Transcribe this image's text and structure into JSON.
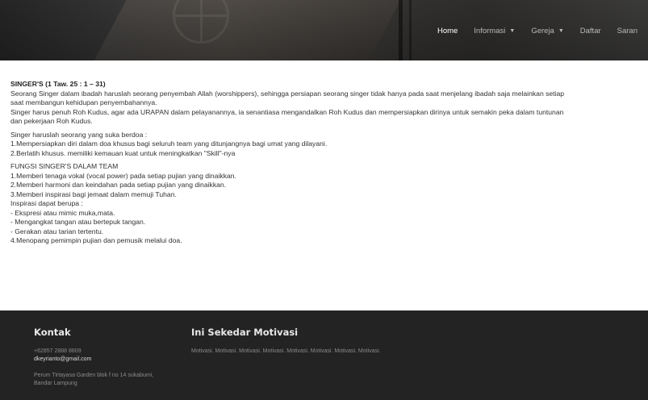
{
  "nav": {
    "items": [
      {
        "label": "Home",
        "active": true,
        "dropdown": false
      },
      {
        "label": "Informasi",
        "active": false,
        "dropdown": true
      },
      {
        "label": "Gereja",
        "active": false,
        "dropdown": true
      },
      {
        "label": "Daftar",
        "active": false,
        "dropdown": false
      },
      {
        "label": "Saran",
        "active": false,
        "dropdown": false
      }
    ],
    "caret_icon": "caret-down-icon"
  },
  "content": {
    "title": "SINGER'S (1 Taw. 25 : 1 – 31)",
    "intro": [
      "Seorang Singer dalam ibadah haruslah seorang penyembah Allah (worshippers), sehingga persiapan seorang singer tidak hanya pada saat menjelang ibadah saja melainkan setiap",
      "saat membangun kehidupan penyembahannya.",
      "Singer harus penuh Roh Kudus, agar ada URAPAN dalam pelayanannya, ia senantiasa mengandalkan Roh Kudus dan mempersiapkan dirinya untuk semakin peka dalam tuntunan",
      "dan pekerjaan Roh Kudus."
    ],
    "berdoa": [
      "Singer haruslah seorang yang suka berdoa :",
      "1.Mempersiapkan diri dalam doa khusus bagi seluruh team yang ditunjangnya bagi umat yang dilayani.",
      "2.Berlatih khusus. memiliki kemauan kuat untuk meningkatkan \"Skill\"-nya"
    ],
    "fungsi": [
      "FUNGSI SINGER'S DALAM TEAM",
      "1.Memberi tenaga vokal (vocal power) pada setiap pujian yang dinaikkan.",
      "2.Memberi harmoni dan keindahan pada setiap pujian yang dinaikkan.",
      "3.Memberi inspirasi bagi jemaat dalam memuji Tuhan.",
      "Inspirasi dapat berupa :",
      "- Ekspresi atau mimic muka,mata.",
      "- Mengangkat tangan atau bertepuk tangan.",
      "- Gerakan atau tarian tertentu.",
      "4.Menopang pemimpin pujian dan pemusik melalui doa."
    ]
  },
  "footer": {
    "kontak": {
      "heading": "Kontak",
      "phone": "+62857 2888 8809",
      "email": "dkeyrianto@gmail.com",
      "address_line1": "Perum Tirtayasa Garden blok f no 14 sukabumi,",
      "address_line2": "Bandar Lampung"
    },
    "motivasi": {
      "heading": "Ini Sekedar Motivasi",
      "text": "Motivasi. Motivasi. Motivasi. Motivasi. Motivasi. Motivasi. Motivasi. Motivasi."
    }
  },
  "colors": {
    "footer_bg": "#232323",
    "nav_active": "#ffffff",
    "nav_inactive": "#b9b9b9"
  }
}
